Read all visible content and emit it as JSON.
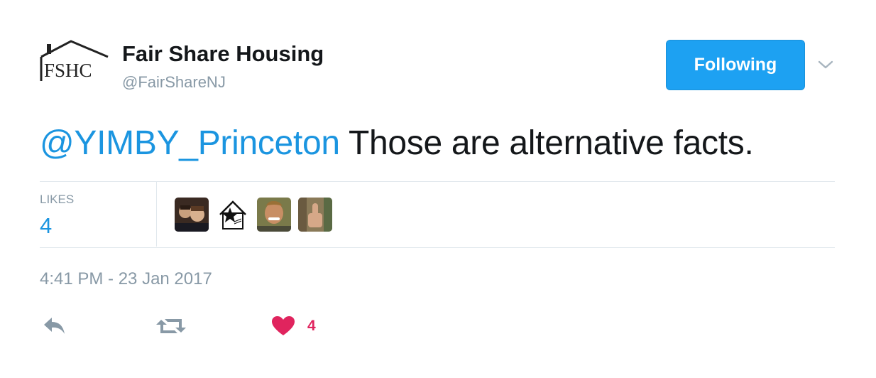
{
  "account": {
    "name": "Fair Share Housing",
    "handle": "@FairShareNJ",
    "logo_text": "FSHC"
  },
  "follow_button": {
    "label": "Following"
  },
  "tweet": {
    "mention": "@YIMBY_Princeton",
    "text": " Those are alternative facts."
  },
  "stats": {
    "likes_label": "LIKES",
    "likes_count": "4",
    "likers": [
      "liker-avatar-couple",
      "liker-avatar-house-star",
      "liker-avatar-woman",
      "liker-avatar-thumbs-up"
    ]
  },
  "timestamp": "4:41 PM - 23 Jan 2017",
  "actions": {
    "reply_icon": "reply-icon",
    "retweet_icon": "retweet-icon",
    "like_icon": "heart-icon",
    "like_count": "4"
  },
  "colors": {
    "accent": "#1da1f2",
    "link": "#1b95e0",
    "like": "#e0245e",
    "muted": "#8899a6"
  }
}
